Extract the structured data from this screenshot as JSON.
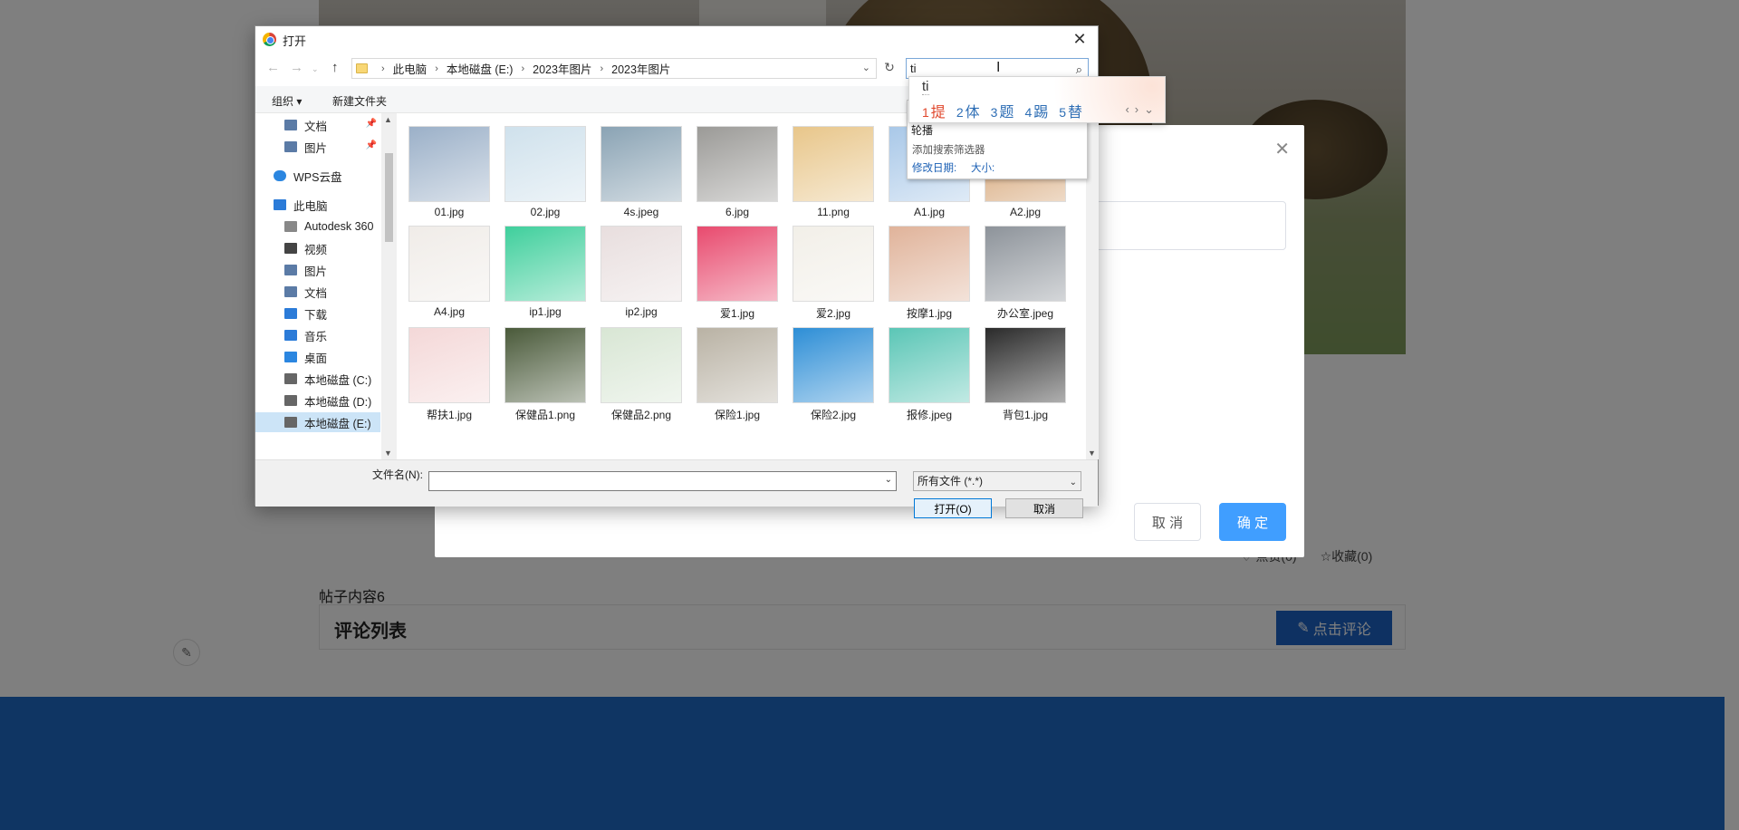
{
  "background": {
    "post_content": "帖子内容6",
    "like_label": "点赞(0)",
    "favorite_label": "收藏(0)",
    "comments_title": "评论列表",
    "comment_button": "点击评论"
  },
  "web_modal": {
    "cancel": "取 消",
    "ok": "确 定"
  },
  "dialog": {
    "title": "打开",
    "breadcrumb": [
      "此电脑",
      "本地磁盘 (E:)",
      "2023年图片",
      "2023年图片"
    ],
    "search_value": "ti",
    "toolbar": {
      "organize": "组织 ▾",
      "new_folder": "新建文件夹"
    },
    "nav_items": [
      {
        "label": "文档",
        "pinned": true,
        "icon": "document-icon"
      },
      {
        "label": "图片",
        "pinned": true,
        "icon": "pictures-icon"
      },
      {
        "label": "WPS云盘",
        "pinned": false,
        "icon": "cloud-icon"
      },
      {
        "label": "此电脑",
        "pinned": false,
        "icon": "computer-icon"
      },
      {
        "label": "Autodesk 360",
        "pinned": false,
        "icon": "autodesk-icon"
      },
      {
        "label": "视频",
        "pinned": false,
        "icon": "video-icon"
      },
      {
        "label": "图片",
        "pinned": false,
        "icon": "pictures-icon"
      },
      {
        "label": "文档",
        "pinned": false,
        "icon": "document-icon"
      },
      {
        "label": "下载",
        "pinned": false,
        "icon": "download-icon"
      },
      {
        "label": "音乐",
        "pinned": false,
        "icon": "music-icon"
      },
      {
        "label": "桌面",
        "pinned": false,
        "icon": "desktop-icon"
      },
      {
        "label": "本地磁盘 (C:)",
        "pinned": false,
        "icon": "drive-icon"
      },
      {
        "label": "本地磁盘 (D:)",
        "pinned": false,
        "icon": "drive-icon"
      },
      {
        "label": "本地磁盘 (E:)",
        "pinned": false,
        "icon": "drive-icon",
        "selected": true
      }
    ],
    "files": [
      {
        "name": "01.jpg",
        "color": "#9bb0c8"
      },
      {
        "name": "02.jpg",
        "color": "#cfe1ec"
      },
      {
        "name": "4s.jpeg",
        "color": "#8aa3b4"
      },
      {
        "name": "6.jpg",
        "color": "#9b9a97"
      },
      {
        "name": "11.png",
        "color": "#e8c68a"
      },
      {
        "name": "A1.jpg",
        "color": "#a9c8e8"
      },
      {
        "name": "A2.jpg",
        "color": "#d29d6a"
      },
      {
        "name": "A4.jpg",
        "color": "#f0ece8"
      },
      {
        "name": "ip1.jpg",
        "color": "#3fcf9c"
      },
      {
        "name": "ip2.jpg",
        "color": "#e8dede"
      },
      {
        "name": "爱1.jpg",
        "color": "#e84a6e"
      },
      {
        "name": "爱2.jpg",
        "color": "#f2efe8"
      },
      {
        "name": "按摩1.jpg",
        "color": "#e0b39a"
      },
      {
        "name": "办公室.jpeg",
        "color": "#8d939a"
      },
      {
        "name": "帮扶1.jpg",
        "color": "#f4d8d8"
      },
      {
        "name": "保健品1.png",
        "color": "#4a5a3a"
      },
      {
        "name": "保健品2.png",
        "color": "#d8e6d4"
      },
      {
        "name": "保险1.jpg",
        "color": "#b9b2a4"
      },
      {
        "name": "保险2.jpg",
        "color": "#2d8ed6"
      },
      {
        "name": "报修.jpeg",
        "color": "#5bc6b6"
      },
      {
        "name": "背包1.jpg",
        "color": "#2a2a2a"
      }
    ],
    "filename_label": "文件名(N):",
    "filename_value": "",
    "filter": "所有文件 (*.*)",
    "open_button": "打开(O)",
    "cancel_button": "取消",
    "search_dropdown": {
      "recent": "轮播",
      "hint": "添加搜索筛选器",
      "modified": "修改日期:",
      "size": "大小:"
    }
  },
  "ime": {
    "composition": "ti",
    "candidates": [
      {
        "num": "1",
        "text": "提"
      },
      {
        "num": "2",
        "text": "体"
      },
      {
        "num": "3",
        "text": "题"
      },
      {
        "num": "4",
        "text": "踢"
      },
      {
        "num": "5",
        "text": "替"
      }
    ]
  }
}
